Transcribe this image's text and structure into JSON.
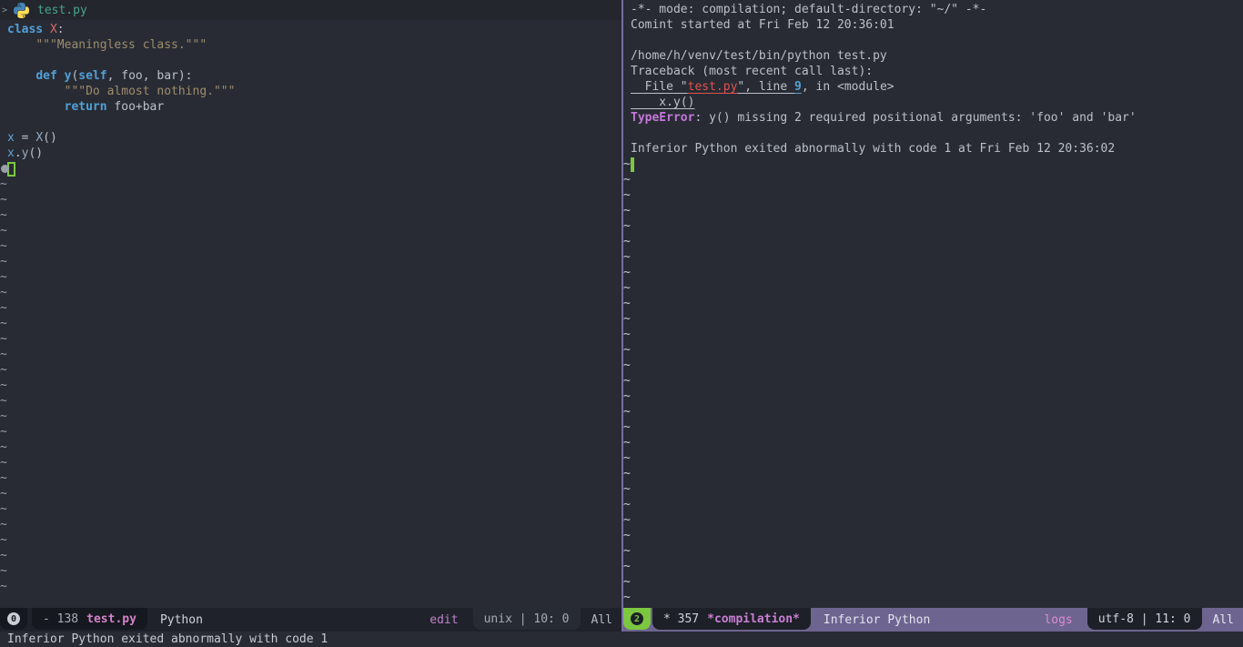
{
  "theme": {
    "background": "#282b33",
    "foreground": "#bac0cb",
    "cursor_green": "#7cc740",
    "modeline_active_bg": "#6e6490",
    "modeline_inactive_bg": "#1f222a",
    "modeline_tab_bg": "#15181e",
    "window_divider": "#756da0",
    "keyword_blue": "#52a0d8",
    "class_name_red": "#d96c6c",
    "docstring_tan": "#9d8d6f",
    "buffer_name_pink": "#d383c9",
    "error_red": "#e05252",
    "type_error_magenta": "#c678dd",
    "tab_label_teal": "#46a58b",
    "winum_green": "#7cc740"
  },
  "left_window": {
    "tab_line": {
      "scroll_indicator": ">",
      "file_name": "test.py"
    },
    "buffer": {
      "tilde_char": "~",
      "tilde_count": 27,
      "cursor_on_first_tilde": false,
      "lines": [
        {
          "tokens": [
            [
              "kw",
              "class"
            ],
            [
              "pl",
              " "
            ],
            [
              "cls",
              "X"
            ],
            [
              "pl",
              ":"
            ]
          ]
        },
        {
          "tokens": [
            [
              "pl",
              "    "
            ],
            [
              "str",
              "\"\"\"Meaningless class.\"\"\""
            ]
          ]
        },
        {
          "tokens": []
        },
        {
          "tokens": [
            [
              "pl",
              "    "
            ],
            [
              "kw",
              "def"
            ],
            [
              "pl",
              " "
            ],
            [
              "fn",
              "y"
            ],
            [
              "pl",
              "("
            ],
            [
              "kw",
              "self"
            ],
            [
              "pl",
              ", foo, bar):"
            ]
          ]
        },
        {
          "tokens": [
            [
              "pl",
              "        "
            ],
            [
              "str",
              "\"\"\"Do almost nothing.\"\"\""
            ]
          ]
        },
        {
          "tokens": [
            [
              "pl",
              "        "
            ],
            [
              "kw",
              "return"
            ],
            [
              "pl",
              " foo+bar"
            ]
          ]
        },
        {
          "tokens": []
        },
        {
          "tokens": [
            [
              "var",
              "x"
            ],
            [
              "pl",
              " = "
            ],
            [
              "var2",
              "X"
            ],
            [
              "pl",
              "()"
            ]
          ]
        },
        {
          "tokens": [
            [
              "var",
              "x"
            ],
            [
              "pl",
              "."
            ],
            [
              "var2",
              "y"
            ],
            [
              "pl",
              "()"
            ]
          ]
        },
        {
          "tokens": [],
          "cursor": "hollow",
          "fringe": "dot"
        }
      ]
    },
    "mode_line": {
      "window_number": "0",
      "buffer_info": "- 138",
      "buffer_name": "test.py",
      "major_mode": "Python",
      "state": "edit",
      "position": "unix | 10: 0",
      "scroll": "All"
    }
  },
  "right_window": {
    "buffer": {
      "tilde_char": "~",
      "tilde_count": 29,
      "cursor_on_first_tilde": true,
      "lines": [
        {
          "tokens": [
            [
              "pl",
              "-*- mode: compilation; default-directory: \"~/\" -*-"
            ]
          ]
        },
        {
          "tokens": [
            [
              "pl",
              "Comint started at Fri Feb 12 20:36:01"
            ]
          ]
        },
        {
          "tokens": []
        },
        {
          "tokens": [
            [
              "pl",
              "/home/h/venv/test/bin/python test.py"
            ]
          ]
        },
        {
          "tokens": [
            [
              "pl",
              "Traceback (most recent call last):"
            ]
          ]
        },
        {
          "tokens": [
            [
              "lnk",
              "  File \""
            ],
            [
              "errfile",
              "test.py"
            ],
            [
              "lnk",
              "\", line "
            ],
            [
              "lnum",
              "9"
            ],
            [
              "pl",
              ", in <module>"
            ]
          ]
        },
        {
          "tokens": [
            [
              "lnk",
              "    x.y()"
            ]
          ]
        },
        {
          "tokens": [
            [
              "terr",
              "TypeError"
            ],
            [
              "pl",
              ": y() missing 2 required positional arguments: 'foo' and 'bar'"
            ]
          ]
        },
        {
          "tokens": []
        },
        {
          "tokens": [
            [
              "pl",
              "Inferior Python exited abnormally with code 1 at Fri Feb 12 20:36:02"
            ]
          ]
        }
      ]
    },
    "mode_line": {
      "window_number": "2",
      "buffer_info": "* 357",
      "buffer_name": "*compilation*",
      "major_mode": "Inferior Python",
      "state": "logs",
      "position": "utf-8 | 11: 0",
      "scroll": "All"
    }
  },
  "echo_area": {
    "message": "Inferior Python exited abnormally with code 1"
  }
}
